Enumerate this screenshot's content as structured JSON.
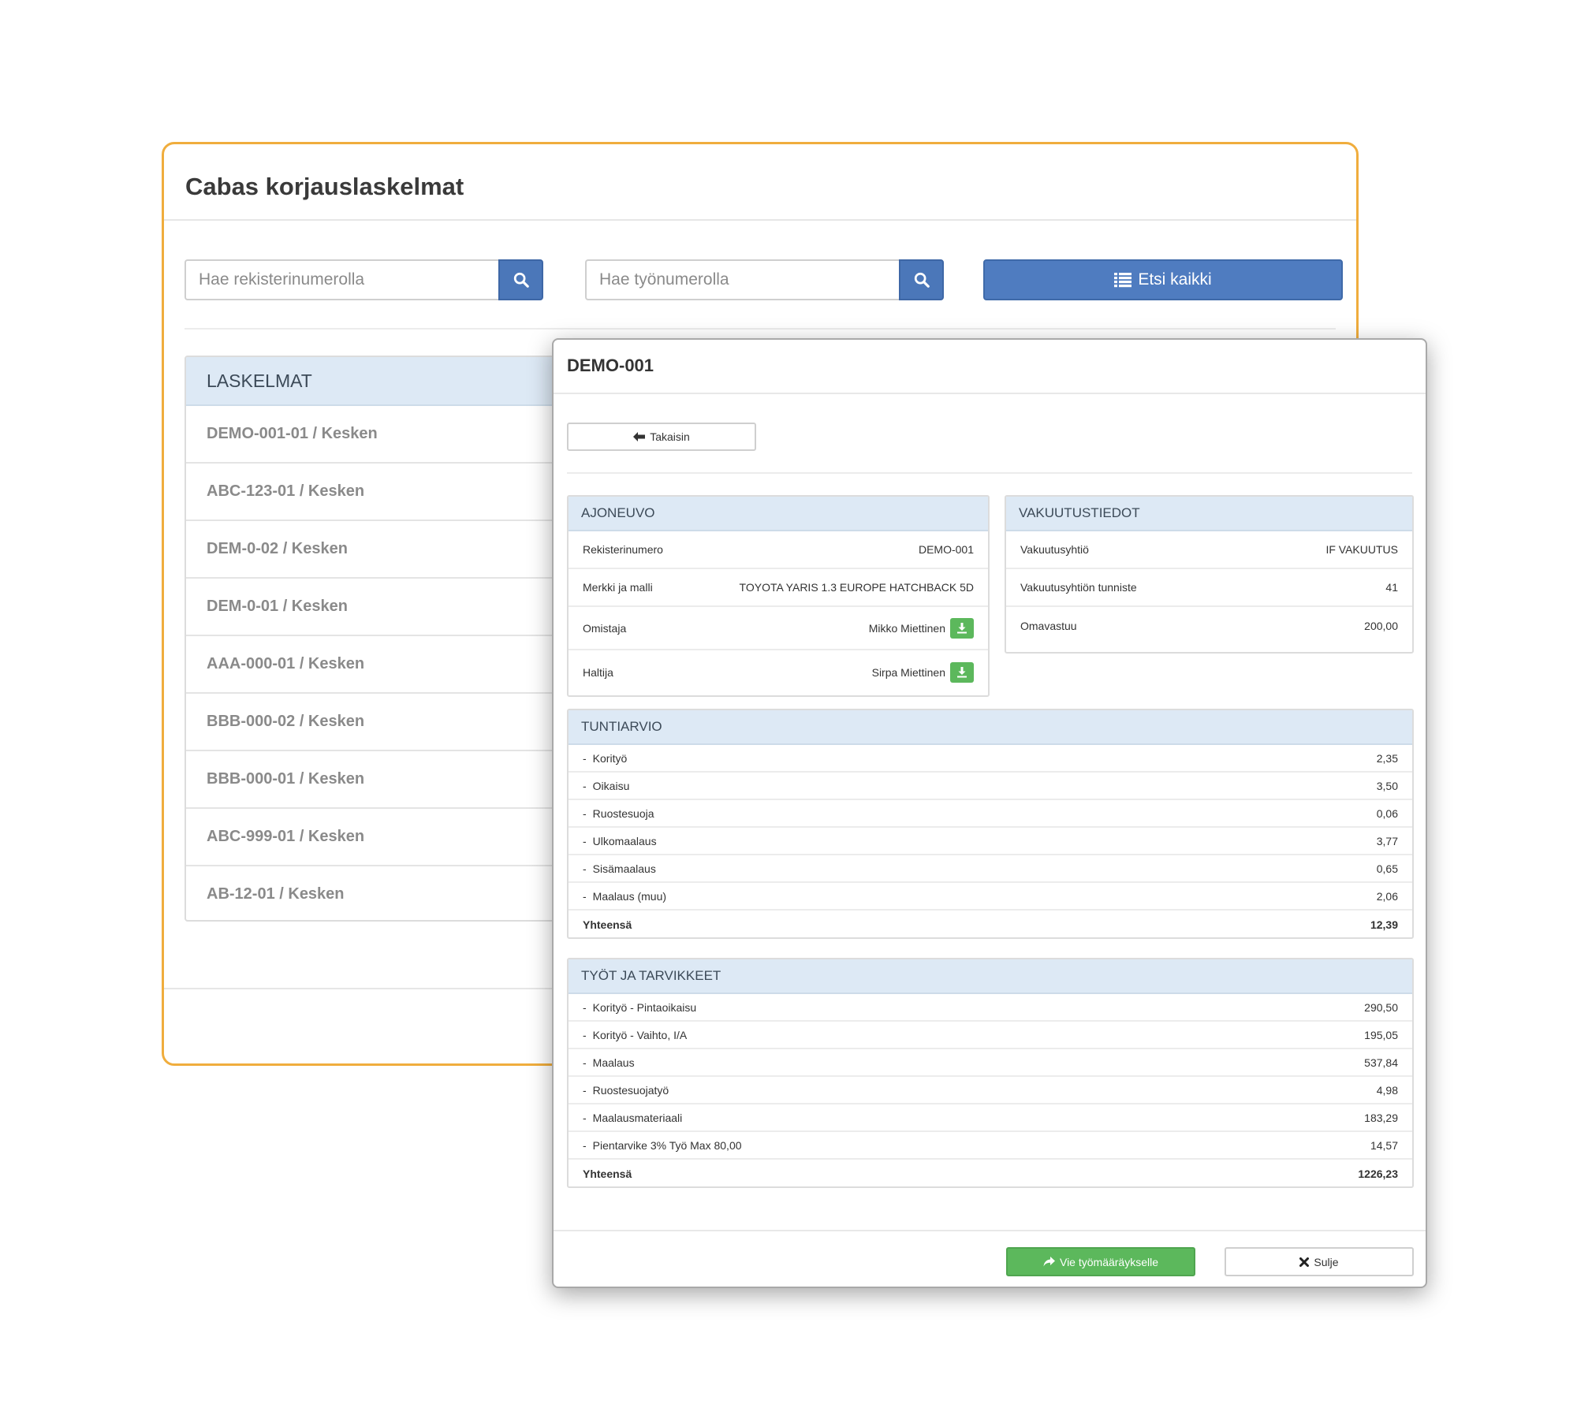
{
  "main": {
    "title": "Cabas korjauslaskelmat",
    "search_reg": {
      "placeholder": "Hae rekisterinumerolla",
      "button_icon": "search-icon"
    },
    "search_work": {
      "placeholder": "Hae työnumerolla",
      "button_icon": "search-icon"
    },
    "find_all": {
      "label": "Etsi kaikki",
      "icon": "list-icon"
    },
    "list": {
      "header": "LASKELMAT",
      "items": [
        "DEMO-001-01 / Kesken",
        "ABC-123-01 / Kesken",
        "DEM-0-02 / Kesken",
        "DEM-0-01 / Kesken",
        "AAA-000-01 / Kesken",
        "BBB-000-02 / Kesken",
        "BBB-000-01 / Kesken",
        "ABC-999-01 / Kesken",
        "AB-12-01 / Kesken"
      ]
    }
  },
  "modal": {
    "title": "DEMO-001",
    "back_label": "Takaisin",
    "vehicle": {
      "header": "AJONEUVO",
      "rows": [
        {
          "label": "Rekisterinumero",
          "value": "DEMO-001"
        },
        {
          "label": "Merkki ja malli",
          "value": "TOYOTA YARIS 1.3 EUROPE HATCHBACK 5D"
        },
        {
          "label": "Omistaja",
          "value": "Mikko Miettinen"
        },
        {
          "label": "Haltija",
          "value": "Sirpa Miettinen"
        }
      ]
    },
    "insurance": {
      "header": "VAKUUTUSTIEDOT",
      "rows": [
        {
          "label": "Vakuutusyhtiö",
          "value": "IF VAKUUTUS"
        },
        {
          "label": "Vakuutusyhtiön tunniste",
          "value": "41"
        },
        {
          "label": "Omavastuu",
          "value": "200,00"
        }
      ]
    },
    "hours": {
      "header": "TUNTIARVIO",
      "dash": "-",
      "rows": [
        {
          "label": "Korityö",
          "value": "2,35"
        },
        {
          "label": "Oikaisu",
          "value": "3,50"
        },
        {
          "label": "Ruostesuoja",
          "value": "0,06"
        },
        {
          "label": "Ulkomaalaus",
          "value": "3,77"
        },
        {
          "label": "Sisämaalaus",
          "value": "0,65"
        },
        {
          "label": "Maalaus (muu)",
          "value": "2,06"
        }
      ],
      "total_label": "Yhteensä",
      "total_value": "12,39"
    },
    "works": {
      "header": "TYÖT JA TARVIKKEET",
      "dash": "-",
      "rows": [
        {
          "label": "Korityö - Pintaoikaisu",
          "value": "290,50"
        },
        {
          "label": "Korityö - Vaihto, I/A",
          "value": "195,05"
        },
        {
          "label": "Maalaus",
          "value": "537,84"
        },
        {
          "label": "Ruostesuojatyö",
          "value": "4,98"
        },
        {
          "label": "Maalausmateriaali",
          "value": "183,29"
        },
        {
          "label": "Pientarvike 3% Työ Max 80,00",
          "value": "14,57"
        }
      ],
      "total_label": "Yhteensä",
      "total_value": "1226,23"
    },
    "export_label": "Vie työmääräykselle",
    "close_label": "Sulje",
    "colors": {
      "accent_orange": "#f0ad3d",
      "primary_blue": "#4f7cc0",
      "success_green": "#5cb85c",
      "panel_head": "#dde9f5"
    }
  }
}
